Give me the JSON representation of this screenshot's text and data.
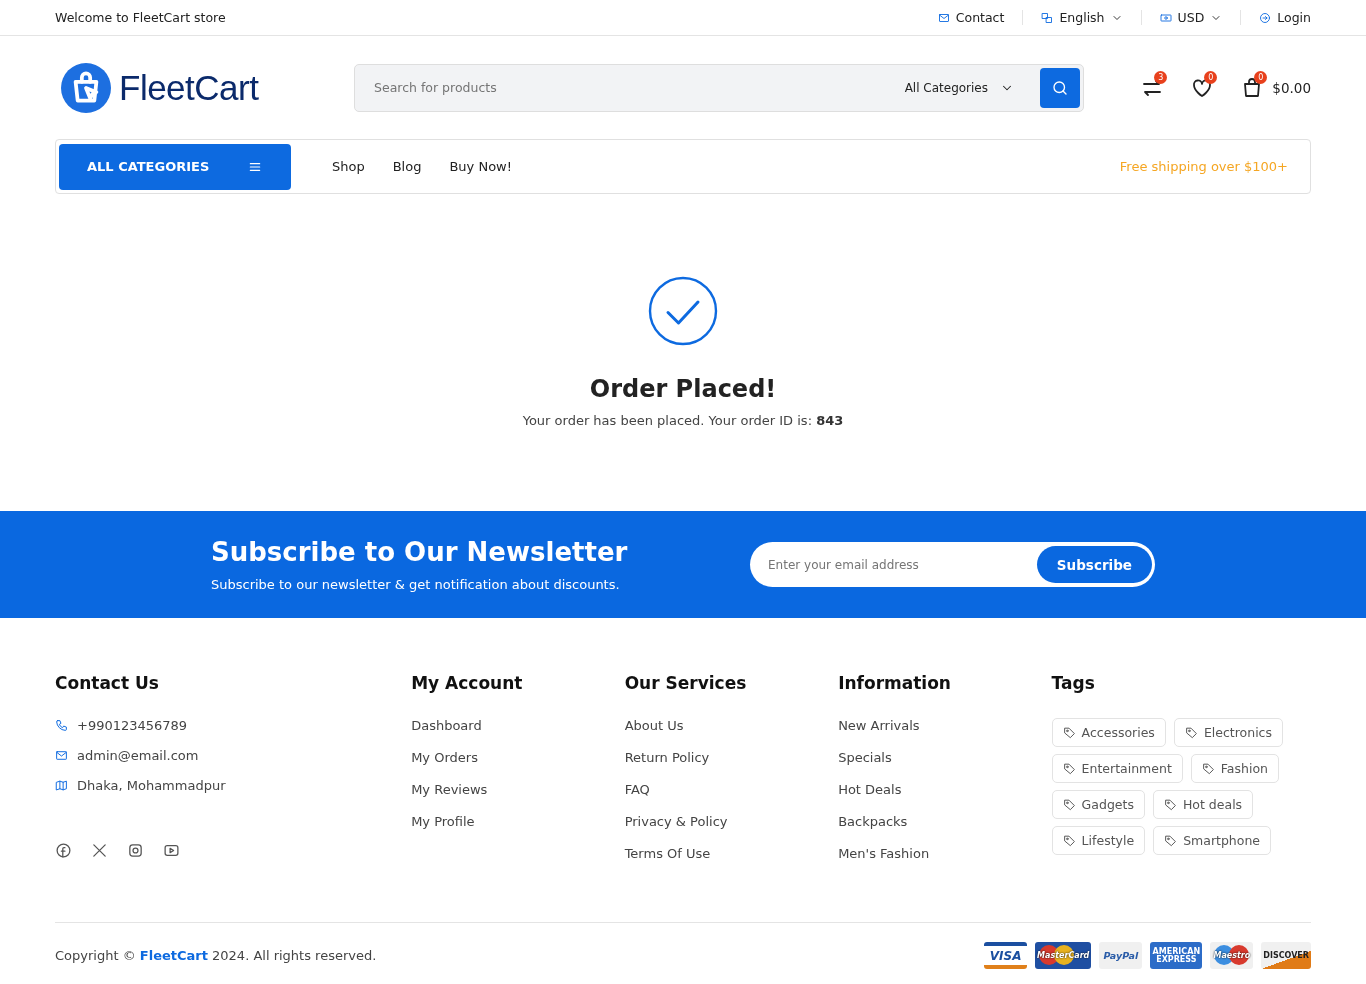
{
  "topbar": {
    "welcome": "Welcome to FleetCart store",
    "links": [
      {
        "kind": "contact",
        "label": "Contact"
      },
      {
        "kind": "language",
        "label": "English"
      },
      {
        "kind": "currency",
        "label": "USD"
      },
      {
        "kind": "login",
        "label": "Login"
      }
    ]
  },
  "header": {
    "logo": "FleetCart",
    "search": {
      "placeholder": "Search for products",
      "category": "All Categories"
    },
    "compare_count": "3",
    "wishlist_count": "0",
    "cart_count": "0",
    "cart_total": "$0.00"
  },
  "nav": {
    "categories_button": "ALL CATEGORIES",
    "links": [
      "Shop",
      "Blog",
      "Buy Now!"
    ],
    "promo": "Free shipping over $100+"
  },
  "confirmation": {
    "title": "Order Placed!",
    "message": "Your order has been placed. Your order ID is: **843**"
  },
  "newsletter": {
    "title": "Subscribe to Our Newsletter",
    "subtitle": "Subscribe to our newsletter & get notification about discounts.",
    "placeholder": "Enter your email address",
    "button": "Subscribe"
  },
  "footer": {
    "contact": {
      "title": "Contact Us",
      "items": [
        {
          "kind": "phone",
          "text": "+990123456789"
        },
        {
          "kind": "email",
          "text": "admin@email.com"
        },
        {
          "kind": "address",
          "text": "Dhaka, Mohammadpur"
        }
      ],
      "social": [
        {
          "kind": "facebook"
        },
        {
          "kind": "x"
        },
        {
          "kind": "instagram"
        },
        {
          "kind": "youtube"
        }
      ]
    },
    "columns": [
      {
        "title": "My Account",
        "links": [
          "Dashboard",
          "My Orders",
          "My Reviews",
          "My Profile"
        ]
      },
      {
        "title": "Our Services",
        "links": [
          "About Us",
          "Return Policy",
          "FAQ",
          "Privacy & Policy",
          "Terms Of Use"
        ]
      },
      {
        "title": "Information",
        "links": [
          "New Arrivals",
          "Specials",
          "Hot Deals",
          "Backpacks",
          "Men's Fashion"
        ]
      }
    ],
    "tags": {
      "title": "Tags",
      "items": [
        "Accessories",
        "Electronics",
        "Entertainment",
        "Fashion",
        "Gadgets",
        "Hot deals",
        "Lifestyle",
        "Smartphone"
      ]
    },
    "copyright": "Copyright © **FleetCart** 2024. All rights reserved.",
    "payments": [
      {
        "kind": "visa",
        "label": "VISA"
      },
      {
        "kind": "mastercard",
        "label": "MasterCard"
      },
      {
        "kind": "paypal",
        "label": "PayPal"
      },
      {
        "kind": "amex",
        "label": "AMERICAN EXPRESS"
      },
      {
        "kind": "maestro",
        "label": "Maestro"
      },
      {
        "kind": "discover",
        "label": "DISCOVER"
      }
    ]
  }
}
